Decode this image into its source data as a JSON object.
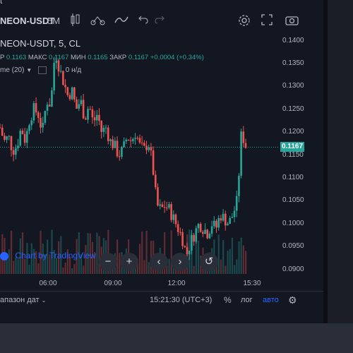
{
  "toolbar": {
    "symbol_partial": "NEON-USDT",
    "interval": "5M",
    "top_right_partial": "t"
  },
  "legend": {
    "title": "NEON-USDT, 5, CL",
    "ohlc_open_label": "P",
    "ohlc_open": "0.1163",
    "ohlc_high_label": "МАКС",
    "ohlc_high": "0.1167",
    "ohlc_low_label": "МИН",
    "ohlc_low": "0.1165",
    "ohlc_close_label": "ЗАКР",
    "ohlc_close": "0.1167",
    "change": "+0.0004 (+0.34%)",
    "volume_label": "me (20)",
    "volume_value": "0",
    "volume_unit": "н/д"
  },
  "price_axis": {
    "ticks": [
      "0.1400",
      "0.1350",
      "0.1300",
      "0.1250",
      "0.1200",
      "0.1150",
      "0.1100",
      "0.1050",
      "0.1000",
      "0.0950",
      "0.0900"
    ],
    "current_price": "0.1167"
  },
  "time_axis": {
    "ticks": [
      "06:00",
      "09:00",
      "12:00",
      "15:30"
    ]
  },
  "watermark": "Chart by TradingView",
  "bottom_bar": {
    "date_range": "апазон дат",
    "clock": "15:21:30 (UTC+3)",
    "percent": "%",
    "log": "лог",
    "auto": "авто"
  },
  "colors": {
    "up": "#26a69a",
    "down": "#ef5350",
    "bg": "#131722",
    "accent": "#2962ff"
  },
  "chart_data": {
    "type": "candlestick",
    "x": [
      "06:00",
      "09:00",
      "12:00",
      "15:30"
    ],
    "ylim": [
      0.09,
      0.14
    ],
    "last_price": 0.1167,
    "close_path": [
      0.121,
      0.118,
      0.119,
      0.116,
      0.117,
      0.121,
      0.118,
      0.123,
      0.125,
      0.124,
      0.12,
      0.127,
      0.126,
      0.138,
      0.134,
      0.131,
      0.128,
      0.129,
      0.125,
      0.127,
      0.123,
      0.126,
      0.122,
      0.124,
      0.12,
      0.121,
      0.118,
      0.117,
      0.115,
      0.116,
      0.119,
      0.118,
      0.12,
      0.117,
      0.116,
      0.118,
      0.113,
      0.104,
      0.103,
      0.104,
      0.103,
      0.101,
      0.099,
      0.097,
      0.093,
      0.096,
      0.098,
      0.1,
      0.099,
      0.098,
      0.1,
      0.099,
      0.102,
      0.101,
      0.1,
      0.102,
      0.105,
      0.12,
      0.117
    ]
  }
}
